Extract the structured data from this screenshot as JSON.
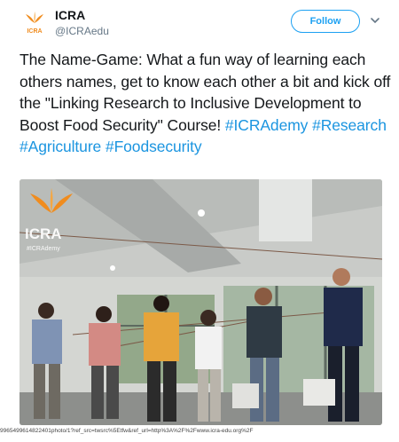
{
  "account": {
    "name": "ICRA",
    "handle": "@ICRAedu",
    "logo_text": "ICRA"
  },
  "follow_label": "Follow",
  "tweet": {
    "text_before": "The Name-Game: What a fun way of learning each others names, get to know each other a bit and kick off the \"Linking Research to Inclusive Development to Boost Food Security\" Course! ",
    "hashtags": [
      "#ICRAdemy",
      "#Research",
      "#Agriculture",
      "#Foodsecurity"
    ]
  },
  "photo": {
    "watermark_text": "ICRA",
    "watermark_tag": "#ICRAdemy"
  },
  "url_text": "9965499614822401photo/1?ref_src=twsrc%5Etfw&ref_url=http%3A%2F%2Fwww.icra-edu.org%2F",
  "colors": {
    "accent": "#1da1f2",
    "hashtag": "#1b95e0",
    "brand_orange": "#f08c1e"
  }
}
